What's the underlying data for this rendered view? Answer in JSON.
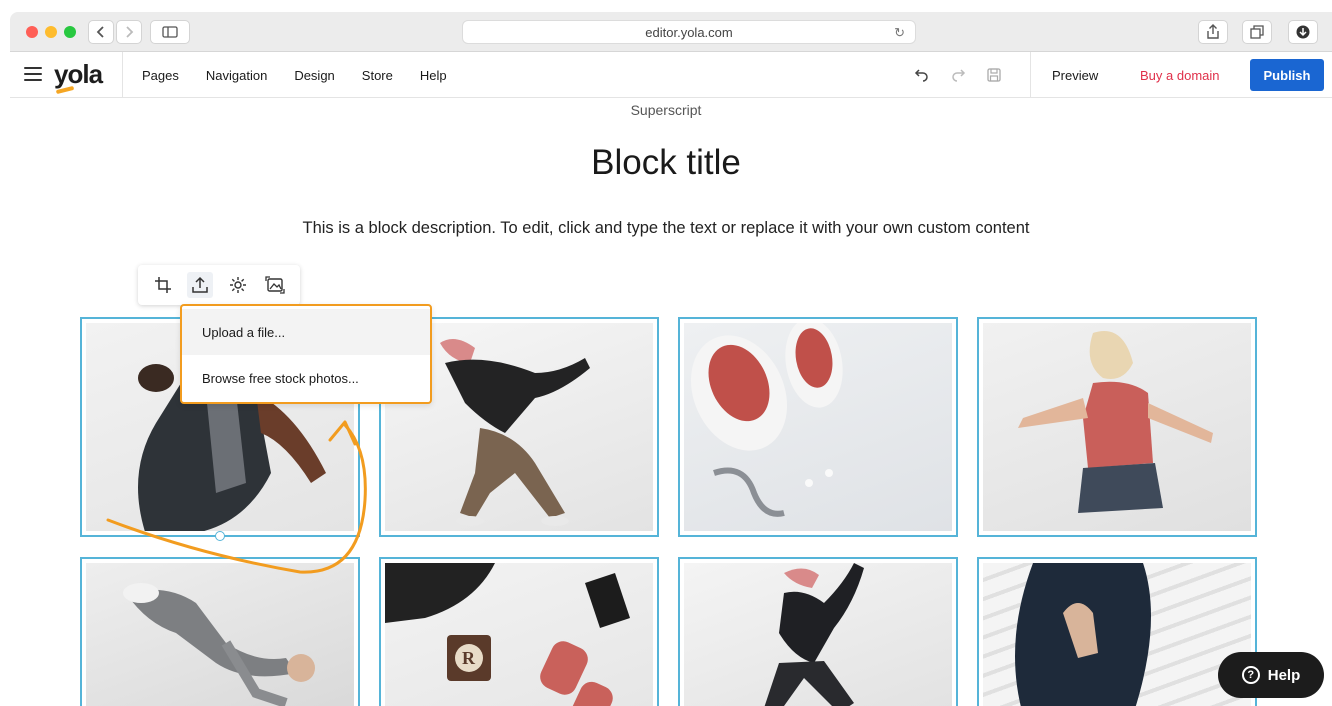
{
  "browser": {
    "url": "editor.yola.com",
    "reload_icon": "reload-icon",
    "share_icon": "share-icon",
    "tabs_icon": "tabs-icon",
    "download_icon": "download-icon"
  },
  "header": {
    "logo": "yola",
    "nav": [
      "Pages",
      "Navigation",
      "Design",
      "Store",
      "Help"
    ],
    "tools": [
      "undo-icon",
      "redo-icon",
      "save-icon"
    ],
    "preview": "Preview",
    "buy_domain": "Buy a domain",
    "publish": "Publish",
    "colors": {
      "publish": "#1a66d2",
      "buy_domain": "#e0304a",
      "logo_accent": "#f5a623"
    }
  },
  "content": {
    "superscript": "Superscript",
    "title": "Block title",
    "description": "This is a block description. To edit, click and type the text or replace it with your own custom content"
  },
  "image_toolbar": {
    "icons": [
      "crop-icon",
      "upload-icon",
      "settings-icon",
      "replace-image-icon"
    ]
  },
  "upload_menu": {
    "items": [
      "Upload a file...",
      "Browse free stock photos..."
    ],
    "highlight_color": "#f29c1f"
  },
  "gallery": {
    "photos": [
      "man-posing-photo",
      "dancer-woman-cap-photo",
      "red-sneakers-photo",
      "woman-red-tank-photo",
      "breakdancer-photo",
      "gym-gear-photo",
      "dancer-woman-cap-2-photo",
      "hooded-figure-photo"
    ],
    "border_color": "#55b4d8"
  },
  "help_button": {
    "label": "Help"
  }
}
